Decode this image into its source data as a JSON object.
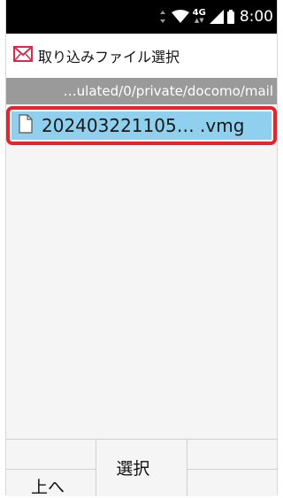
{
  "status_bar": {
    "network": "4G",
    "time": "8:00",
    "icons": [
      "data-arrows-icon",
      "wifi-icon",
      "signal-icon",
      "battery-icon"
    ]
  },
  "header": {
    "icon": "mail-envelope-icon",
    "title": "取り込みファイル選択"
  },
  "path": "…ulated/0/private/docomo/mail",
  "files": [
    {
      "icon": "file-icon",
      "name": "202403221105… .vmg",
      "selected": true
    }
  ],
  "softkeys": {
    "left": "上へ",
    "center": "選択",
    "right": ""
  },
  "colors": {
    "selection": "#8fd0ee",
    "highlight_border": "#e8232a",
    "path_bar": "#9a9a9a"
  }
}
